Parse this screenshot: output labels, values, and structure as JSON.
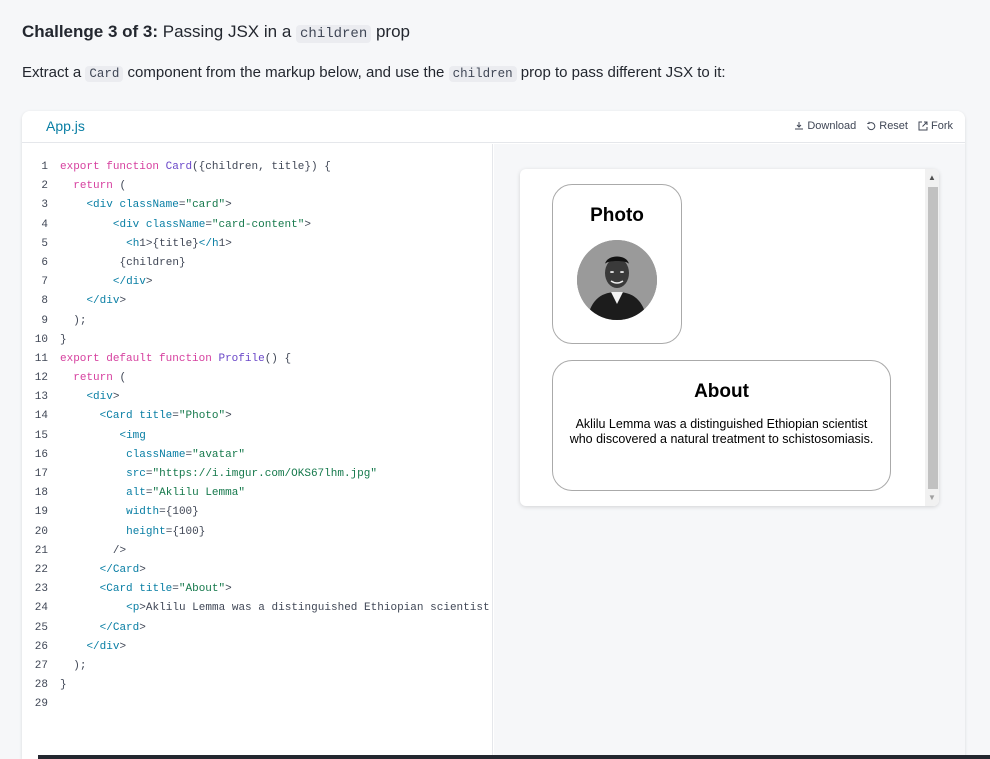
{
  "challenge": {
    "prefix": "Challenge 3 of 3:",
    "title_before": "Passing JSX in a",
    "title_code": "children",
    "title_after": "prop"
  },
  "description": {
    "before": "Extract a",
    "code1": "Card",
    "middle": "component from the markup below, and use the",
    "code2": "children",
    "after": "prop to pass different JSX to it:"
  },
  "sandbox": {
    "tab_label": "App.js",
    "actions": {
      "download": "Download",
      "reset": "Reset",
      "fork": "Fork"
    },
    "code_lines": [
      "export function Card({children, title}) {",
      "  return (",
      "    <div className=\"card\">",
      "        <div className=\"card-content\">",
      "          <h1>{title}</h1>",
      "         {children}",
      "        </div>",
      "    </div>",
      "  );",
      "}",
      "export default function Profile() {",
      "  return (",
      "    <div>",
      "      <Card title=\"Photo\">",
      "         <img",
      "          className=\"avatar\"",
      "          src=\"https://i.imgur.com/OKS67lhm.jpg\"",
      "          alt=\"Aklilu Lemma\"",
      "          width={100}",
      "          height={100}",
      "        />",
      "      </Card>",
      "      <Card title=\"About\">",
      "          <p>Aklilu Lemma was a distinguished Ethiopian scientist w",
      "      </Card>",
      "    </div>",
      "  );",
      "}",
      ""
    ]
  },
  "preview": {
    "photo_card_title": "Photo",
    "about_card_title": "About",
    "about_text": "Aklilu Lemma was a distinguished Ethiopian scientist who discovered a natural treatment to schistosomiasis."
  },
  "colors": {
    "accent": "#087ea4",
    "keyword": "#d6409f",
    "function": "#6a47c8",
    "string": "#16794c"
  }
}
